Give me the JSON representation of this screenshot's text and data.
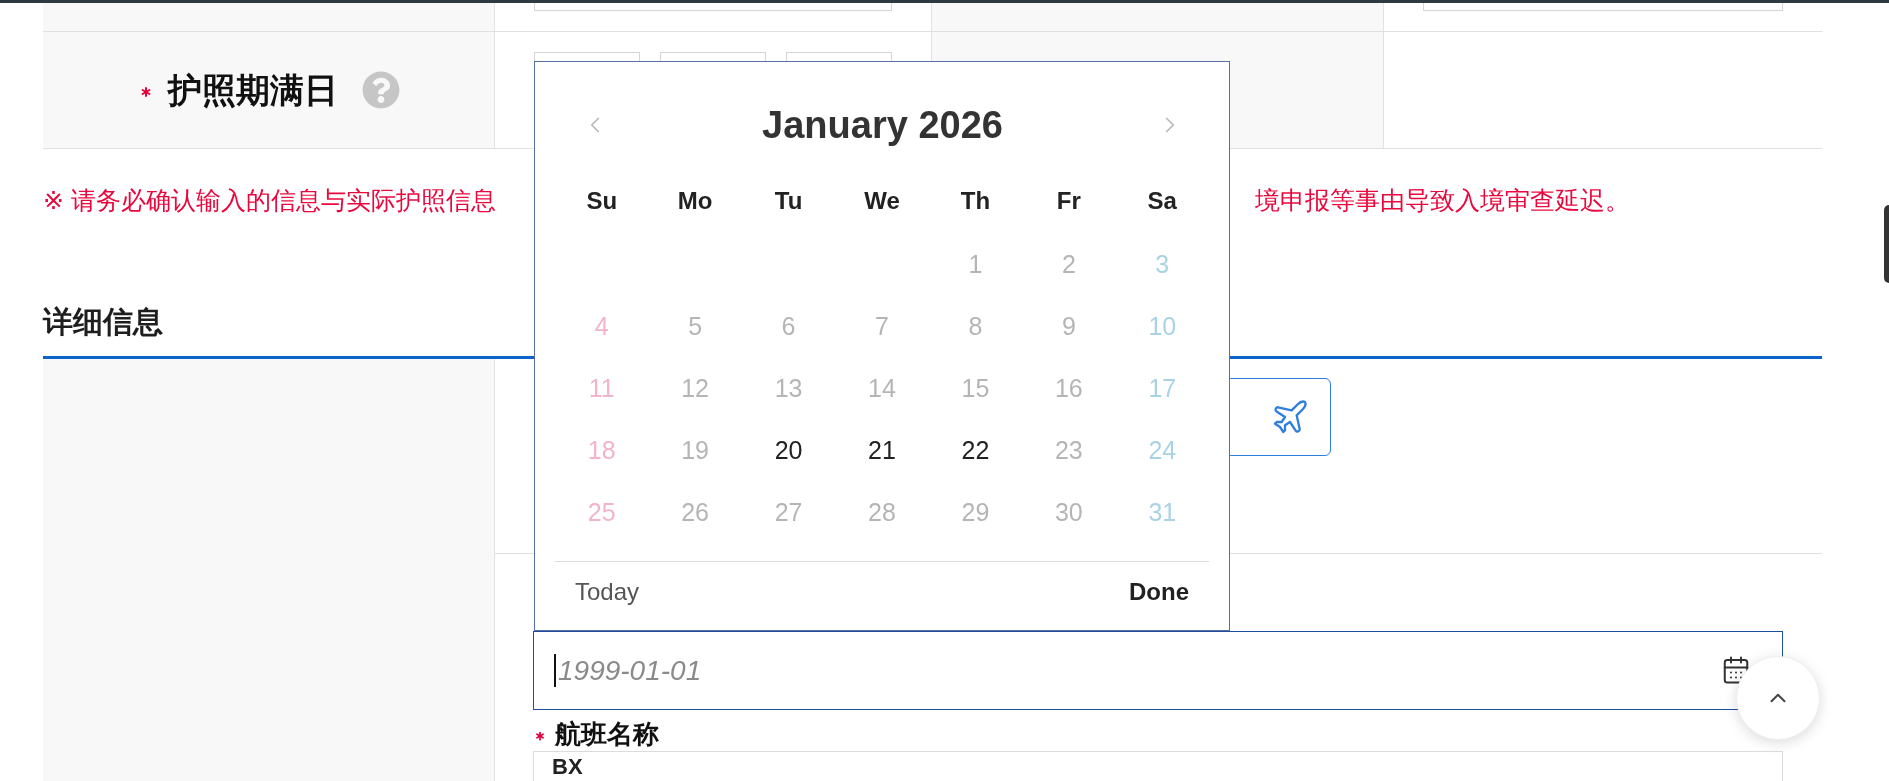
{
  "top_table": {
    "rows": [
      {
        "cells": [
          {
            "kind": "label"
          },
          {
            "kind": "value",
            "controls": [
              {
                "kind": "text_input"
              }
            ]
          },
          {
            "kind": "label"
          },
          {
            "kind": "value",
            "controls": [
              {
                "kind": "text_input"
              }
            ]
          }
        ]
      },
      {
        "cells": [
          {
            "kind": "label",
            "text": "护照期满日",
            "required": true,
            "help": true
          },
          {
            "kind": "value",
            "controls": [
              {
                "kind": "select"
              },
              {
                "kind": "select"
              },
              {
                "kind": "select"
              }
            ]
          },
          {
            "kind": "label"
          },
          {
            "kind": "value"
          }
        ]
      }
    ]
  },
  "notice": {
    "parts": [
      "※ 请务必确认输入的信息与实际护照信息",
      "境申报等事由导致入境审查延迟。"
    ]
  },
  "section": {
    "title": "详细信息"
  },
  "details": {
    "rows": [
      {
        "fields": [
          {
            "kind": "flight_search_button"
          }
        ]
      },
      {
        "fields": [
          {
            "kind": "date_input",
            "placeholder": "1999-01-01",
            "focused": true
          },
          {
            "kind": "label",
            "text": "航班名称",
            "required": true
          },
          {
            "kind": "text_input",
            "value": "BX",
            "focused": false
          }
        ]
      }
    ]
  },
  "datepicker": {
    "title": "January 2026",
    "weekdays": [
      "Su",
      "Mo",
      "Tu",
      "We",
      "Th",
      "Fr",
      "Sa"
    ],
    "weeks": [
      {
        "days": [
          {
            "label": "1",
            "disabled": true
          },
          {
            "label": "2",
            "disabled": true
          },
          {
            "label": "3",
            "disabled": true
          }
        ]
      },
      {
        "days": [
          {
            "label": "4",
            "disabled": true
          },
          {
            "label": "5",
            "disabled": true
          },
          {
            "label": "6",
            "disabled": true
          },
          {
            "label": "7",
            "disabled": true
          },
          {
            "label": "8",
            "disabled": true
          },
          {
            "label": "9",
            "disabled": true
          },
          {
            "label": "10",
            "disabled": true
          }
        ]
      },
      {
        "days": [
          {
            "label": "11",
            "disabled": true
          },
          {
            "label": "12",
            "disabled": true
          },
          {
            "label": "13",
            "disabled": true
          },
          {
            "label": "14",
            "disabled": true
          },
          {
            "label": "15",
            "disabled": true
          },
          {
            "label": "16",
            "disabled": true
          },
          {
            "label": "17",
            "disabled": true
          }
        ]
      },
      {
        "days": [
          {
            "label": "18",
            "disabled": true
          },
          {
            "label": "19",
            "disabled": true
          },
          {
            "label": "20",
            "disabled": false
          },
          {
            "label": "21",
            "disabled": false
          },
          {
            "label": "22",
            "disabled": false
          },
          {
            "label": "23",
            "disabled": true
          },
          {
            "label": "24",
            "disabled": true
          }
        ]
      },
      {
        "days": [
          {
            "label": "25",
            "disabled": true
          },
          {
            "label": "26",
            "disabled": true
          },
          {
            "label": "27",
            "disabled": true
          },
          {
            "label": "28",
            "disabled": true
          },
          {
            "label": "29",
            "disabled": true
          },
          {
            "label": "30",
            "disabled": true
          },
          {
            "label": "31",
            "disabled": true
          }
        ]
      }
    ],
    "buttons": [
      {
        "kind": "today",
        "label": "Today"
      },
      {
        "kind": "done",
        "label": "Done"
      }
    ]
  }
}
